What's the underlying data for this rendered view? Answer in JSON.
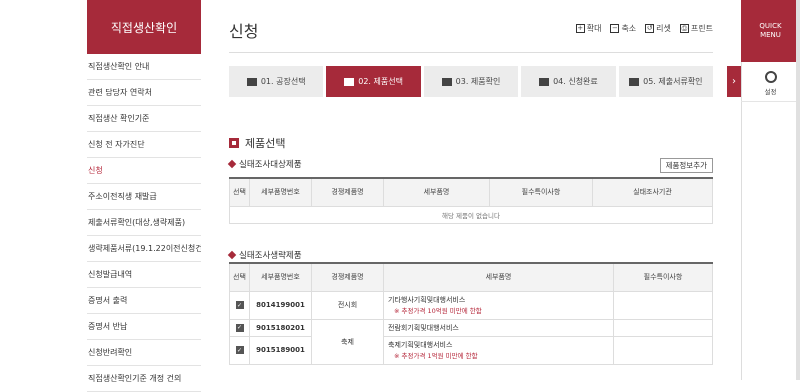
{
  "sidebar": {
    "title": "직접생산확인",
    "items": [
      {
        "label": "직접생산확인 안내",
        "active": false
      },
      {
        "label": "관련 담당자 연락처",
        "active": false
      },
      {
        "label": "직접생산 확인기준",
        "active": false
      },
      {
        "label": "신청 전 자가진단",
        "active": false
      },
      {
        "label": "신청",
        "active": true
      },
      {
        "label": "주소이전직생 재발급",
        "active": false
      },
      {
        "label": "제출서류확인(대상,생략제품)",
        "active": false
      },
      {
        "label": "생략제품서류(19.1.22이전신청건)",
        "active": false
      },
      {
        "label": "신청발급내역",
        "active": false
      },
      {
        "label": "증명서 출력",
        "active": false
      },
      {
        "label": "증명서 반납",
        "active": false
      },
      {
        "label": "신청반려확인",
        "active": false
      },
      {
        "label": "직접생산확인기준 개정 건의",
        "active": false
      }
    ]
  },
  "header": {
    "title": "신청",
    "tools": [
      {
        "label": "확대",
        "icon": "zoom-in-icon",
        "glyph": "+"
      },
      {
        "label": "축소",
        "icon": "zoom-out-icon",
        "glyph": "−"
      },
      {
        "label": "리셋",
        "icon": "reset-icon",
        "glyph": "↺"
      },
      {
        "label": "프린트",
        "icon": "print-icon",
        "glyph": "⎙"
      }
    ]
  },
  "steps": [
    {
      "label": "01. 공장선택",
      "icon": "factory-icon",
      "active": false
    },
    {
      "label": "02. 제품선택",
      "icon": "cart-icon",
      "active": true
    },
    {
      "label": "03. 제품확인",
      "icon": "box-icon",
      "active": false
    },
    {
      "label": "04. 신청완료",
      "icon": "check-icon",
      "active": false
    },
    {
      "label": "05. 제출서류확인",
      "icon": "document-icon",
      "active": false
    }
  ],
  "section": {
    "title": "제품선택",
    "survey": {
      "title": "실태조사대상제품",
      "button": "제품정보추가",
      "headers": [
        "선택",
        "세부품명번호",
        "경쟁제품명",
        "세부품명",
        "필수특이사항",
        "실태조사기관"
      ],
      "empty": "해당 제품이 없습니다"
    },
    "omitted": {
      "title": "실태조사생략제품",
      "headers": [
        "선택",
        "세부품명번호",
        "경쟁제품명",
        "세부품명",
        "필수특이사항"
      ],
      "rows": [
        {
          "checked": true,
          "code": "8014199001",
          "product": "전시회",
          "detail": "기타행사기획및대행서비스",
          "note": "※ 추정가격 10억원 미만에 한함"
        },
        {
          "checked": true,
          "code": "9015180201",
          "product": "축제",
          "detail": "전람회기획및대행서비스",
          "note": ""
        },
        {
          "checked": true,
          "code": "9015189001",
          "product": "",
          "detail": "축제기획및대행서비스",
          "note": "※ 추정가격 1억원 미만에 한함"
        }
      ]
    }
  },
  "right_panel": {
    "quick_menu": "QUICK MENU",
    "setting": "설정",
    "next_arrow": "›"
  },
  "colors": {
    "accent": "#a62a3a"
  }
}
